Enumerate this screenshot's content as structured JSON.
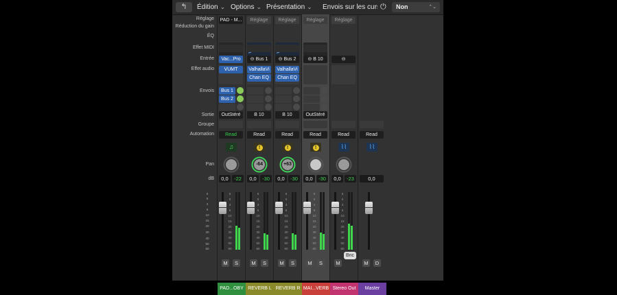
{
  "menubar": {
    "back_icon": "↰",
    "edition": "Édition",
    "options": "Options",
    "presentation": "Présentation",
    "sends_label": "Envois sur les curseurs :",
    "value": "Non"
  },
  "row_labels": {
    "setting": "Réglage",
    "gain_reduction": "Réduction du gain",
    "eq": "ÉQ",
    "midi_fx": "Effet MIDI",
    "input": "Entrée",
    "audio_fx": "Effet audio",
    "sends": "Envois",
    "output": "Sortie",
    "group": "Groupe",
    "automation": "Automation",
    "pan": "Pan",
    "db": "dB"
  },
  "fader_scale": [
    "6",
    "0",
    "3",
    "6",
    "10",
    "15",
    "20",
    "30",
    "40",
    "50",
    "60"
  ],
  "bounce_label": "Bnc",
  "strips": [
    {
      "name": "PAD...OBY",
      "name_color": "#2f8f3f",
      "setting": "PAD - M...",
      "input": "Vac...Pro",
      "plugins": [
        "VUMT"
      ],
      "sends": [
        "Bus 1",
        "Bus 2"
      ],
      "output": "OutStéré",
      "automation": "Read",
      "icon": "music-note",
      "pan": "",
      "db_value": "0,0",
      "db_peak": "-22",
      "mute": "M",
      "solo": "S",
      "meter_level": 0.42,
      "selected": false
    },
    {
      "name": "REVERB L",
      "name_color": "#8a8a2a",
      "setting": "Réglage",
      "input": "Bus 1",
      "plugins": [
        "ValhallaVi",
        "Chan EQ"
      ],
      "sends": [],
      "output": "B 10",
      "automation": "Read",
      "icon": "warning",
      "pan": "-64",
      "db_value": "0,0",
      "db_peak": "-30",
      "mute": "M",
      "solo": "S",
      "meter_level": 0.28,
      "selected": false
    },
    {
      "name": "REVERB R",
      "name_color": "#8a8a2a",
      "setting": "Réglage",
      "input": "Bus 2",
      "plugins": [
        "ValhallaVi",
        "Chan EQ"
      ],
      "sends": [],
      "output": "B 10",
      "automation": "Read",
      "icon": "warning",
      "pan": "+63",
      "db_value": "0,0",
      "db_peak": "-30",
      "mute": "M",
      "solo": "S",
      "meter_level": 0.28,
      "selected": false
    },
    {
      "name": "MAI...VERB",
      "name_color": "#c9403a",
      "setting": "Réglage",
      "input": "B 10",
      "plugins": [],
      "sends": [],
      "output": "OutStéré",
      "automation": "Read",
      "icon": "warning",
      "pan": "",
      "db_value": "0,0",
      "db_peak": "-30",
      "mute": "M",
      "solo": "S",
      "meter_level": 0.3,
      "selected": true
    },
    {
      "name": "Stereo Out",
      "name_color": "#c23470",
      "setting": "Réglage",
      "input": "",
      "plugins": [],
      "sends": [],
      "output": "",
      "automation": "Read",
      "icon": "waveform",
      "pan": "",
      "db_value": "0,0",
      "db_peak": "-23",
      "mute": "M",
      "solo": "",
      "meter_level": 0.45,
      "selected": false
    },
    {
      "name": "Master",
      "name_color": "#6a3fa0",
      "setting": "",
      "input": "",
      "plugins": [],
      "sends": [],
      "output": "",
      "automation": "Read",
      "icon": "waveform",
      "pan": "",
      "db_value": "0,0",
      "db_peak": "",
      "mute": "M",
      "solo": "D",
      "meter_level": 0,
      "selected": false
    }
  ]
}
